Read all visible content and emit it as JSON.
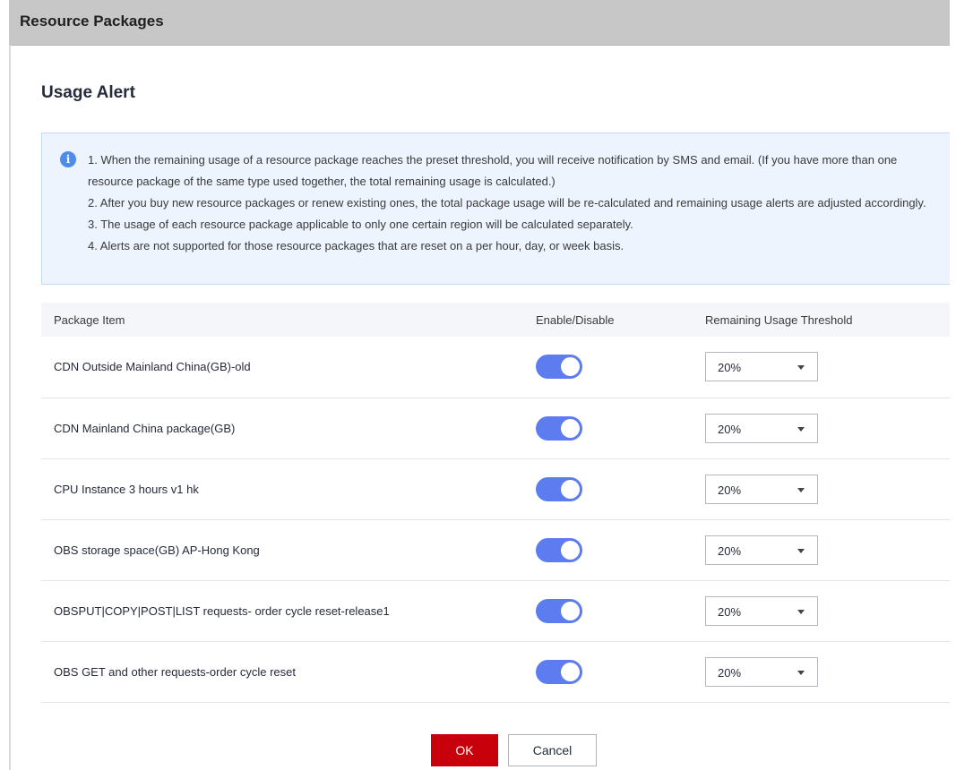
{
  "header": {
    "title": "Resource Packages"
  },
  "dialog": {
    "title": "Usage Alert",
    "notice": [
      "1. When the remaining usage of a resource package reaches the preset threshold, you will receive notification by SMS and email. (If you have more than one resource package of the same type used together, the total remaining usage is calculated.)",
      "2. After you buy new resource packages or renew existing ones, the total package usage will be re-calculated and remaining usage alerts are adjusted accordingly.",
      "3. The usage of each resource package applicable to only one certain region will be calculated separately.",
      "4. Alerts are not supported for those resource packages that are reset on a per hour, day, or week basis."
    ],
    "columns": {
      "item": "Package Item",
      "toggle": "Enable/Disable",
      "threshold": "Remaining Usage Threshold"
    },
    "rows": [
      {
        "item": "CDN Outside Mainland China(GB)-old",
        "enabled": true,
        "threshold": "20%"
      },
      {
        "item": "CDN Mainland China package(GB)",
        "enabled": true,
        "threshold": "20%"
      },
      {
        "item": "CPU Instance 3 hours v1 hk",
        "enabled": true,
        "threshold": "20%"
      },
      {
        "item": "OBS storage space(GB) AP-Hong Kong",
        "enabled": true,
        "threshold": "20%"
      },
      {
        "item": "OBSPUT|COPY|POST|LIST requests- order cycle reset-release1",
        "enabled": true,
        "threshold": "20%"
      },
      {
        "item": "OBS GET and other requests-order cycle reset",
        "enabled": true,
        "threshold": "20%"
      }
    ],
    "ok_label": "OK",
    "cancel_label": "Cancel"
  },
  "colors": {
    "accent": "#5c7cf0",
    "primary_button": "#c7000b",
    "info": "#4d8ceb"
  }
}
